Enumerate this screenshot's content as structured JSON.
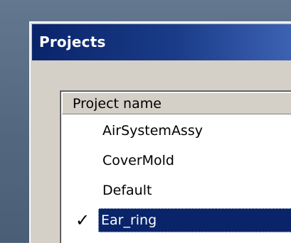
{
  "window": {
    "title": "Projects"
  },
  "list": {
    "header": "Project name",
    "items": [
      {
        "label": "AirSystemAssy",
        "checked": false,
        "selected": false
      },
      {
        "label": "CoverMold",
        "checked": false,
        "selected": false
      },
      {
        "label": "Default",
        "checked": false,
        "selected": false
      },
      {
        "label": "Ear_ring",
        "checked": true,
        "selected": true
      }
    ],
    "check_glyph": "✓"
  },
  "colors": {
    "titlebar_start": "#0a246a",
    "titlebar_end": "#3d62b3",
    "selection": "#0a246a",
    "dialog_face": "#d4d0c8",
    "desktop": "#5a6f86"
  },
  "icons": {
    "check": "checkmark-icon"
  }
}
